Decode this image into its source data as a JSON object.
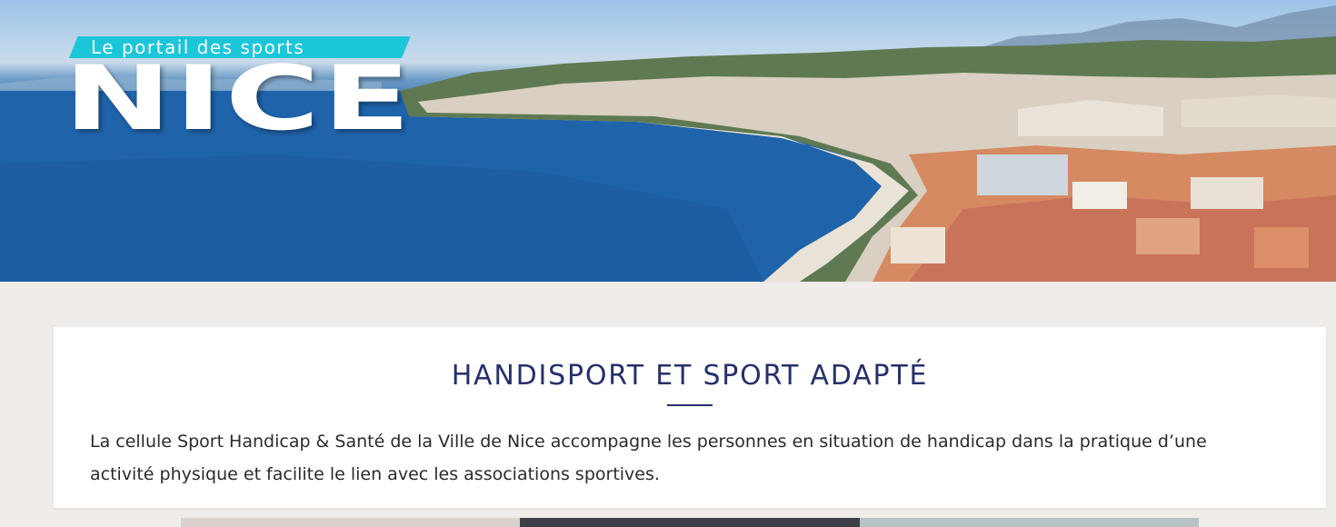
{
  "hero": {
    "logo_tagline": "Le portail des sports",
    "logo_word": "NICE"
  },
  "section": {
    "title": "HANDISPORT ET SPORT ADAPTÉ",
    "intro": "La cellule Sport Handicap & Santé de la Ville de Nice accompagne les personnes en situation de handicap dans la pratique d’une activité physique et facilite le lien avec les associations sportives."
  },
  "colors": {
    "title": "#27306a",
    "tagline_bg": "#1cc6d9",
    "page_bg": "#efecea"
  }
}
